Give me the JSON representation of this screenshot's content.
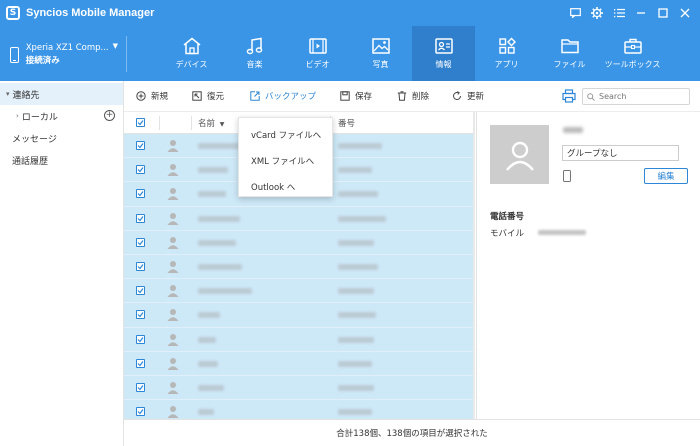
{
  "app": {
    "logo_letter": "S",
    "title": "Syncios Mobile Manager",
    "controls": [
      "message-icon",
      "gear-icon",
      "menu-icon",
      "minimize-icon",
      "maximize-icon",
      "close-icon"
    ]
  },
  "device": {
    "name": "Xperia XZ1 Comp...",
    "status": "接続済み"
  },
  "nav": {
    "tabs": [
      {
        "label": "デバイス",
        "icon": "home-icon"
      },
      {
        "label": "音楽",
        "icon": "music-icon"
      },
      {
        "label": "ビデオ",
        "icon": "video-icon"
      },
      {
        "label": "写真",
        "icon": "photo-icon"
      },
      {
        "label": "情報",
        "icon": "contact-card-icon",
        "active": true
      },
      {
        "label": "アプリ",
        "icon": "apps-icon"
      },
      {
        "label": "ファイル",
        "icon": "folder-icon"
      },
      {
        "label": "ツールボックス",
        "icon": "toolbox-icon"
      }
    ]
  },
  "sidebar": {
    "items": [
      {
        "label": "連絡先",
        "expanded": true,
        "selected": true
      },
      {
        "label": "ローカル",
        "sub": true
      },
      {
        "label": "メッセージ"
      },
      {
        "label": "通話履歴"
      }
    ]
  },
  "toolbar": {
    "new": "新規",
    "restore": "復元",
    "backup": "バックアップ",
    "save": "保存",
    "delete": "削除",
    "refresh": "更新",
    "search_placeholder": "Search"
  },
  "list": {
    "col_name": "名前",
    "col_number": "番号",
    "row_count": 12
  },
  "dropdown": {
    "items": [
      "vCard ファイルへ",
      "XML ファイルへ",
      "Outlook へ"
    ]
  },
  "detail": {
    "group": "グループなし",
    "edit": "編集",
    "phone_section": "電話番号",
    "mobile_label": "モバイル"
  },
  "status": {
    "text": "合計138個、138個の項目が選択された"
  },
  "colors": {
    "primary": "#3a95e6",
    "active_tab": "#2f7fcd",
    "selected_row": "#cde8f7",
    "accent": "#2d86d6"
  }
}
